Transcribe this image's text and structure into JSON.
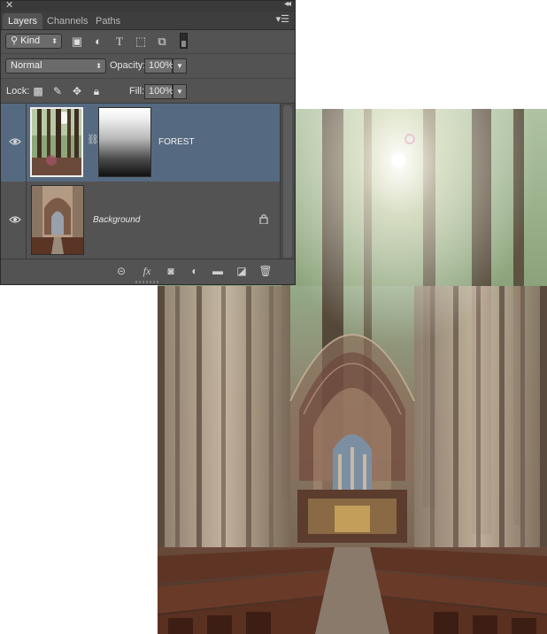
{
  "panel": {
    "tabs": [
      {
        "label": "Layers",
        "active": true
      },
      {
        "label": "Channels",
        "active": false
      },
      {
        "label": "Paths",
        "active": false
      }
    ],
    "filter": {
      "kind_label": "Kind"
    },
    "blend_mode": "Normal",
    "opacity_label": "Opacity:",
    "opacity_value": "100%",
    "lock_label": "Lock:",
    "fill_label": "Fill:",
    "fill_value": "100%",
    "layers": [
      {
        "name": "FOREST",
        "visible": true,
        "selected": true,
        "has_mask": true,
        "linked": true
      },
      {
        "name": "Background",
        "visible": true,
        "selected": false,
        "locked": true
      }
    ],
    "footer_icons": [
      "link-layers-icon",
      "fx-icon",
      "add-mask-icon",
      "adjustment-layer-icon",
      "group-folder-icon",
      "new-layer-icon",
      "trash-icon"
    ]
  },
  "colors": {
    "panel_bg": "#535353",
    "selected_layer": "#556a80"
  }
}
